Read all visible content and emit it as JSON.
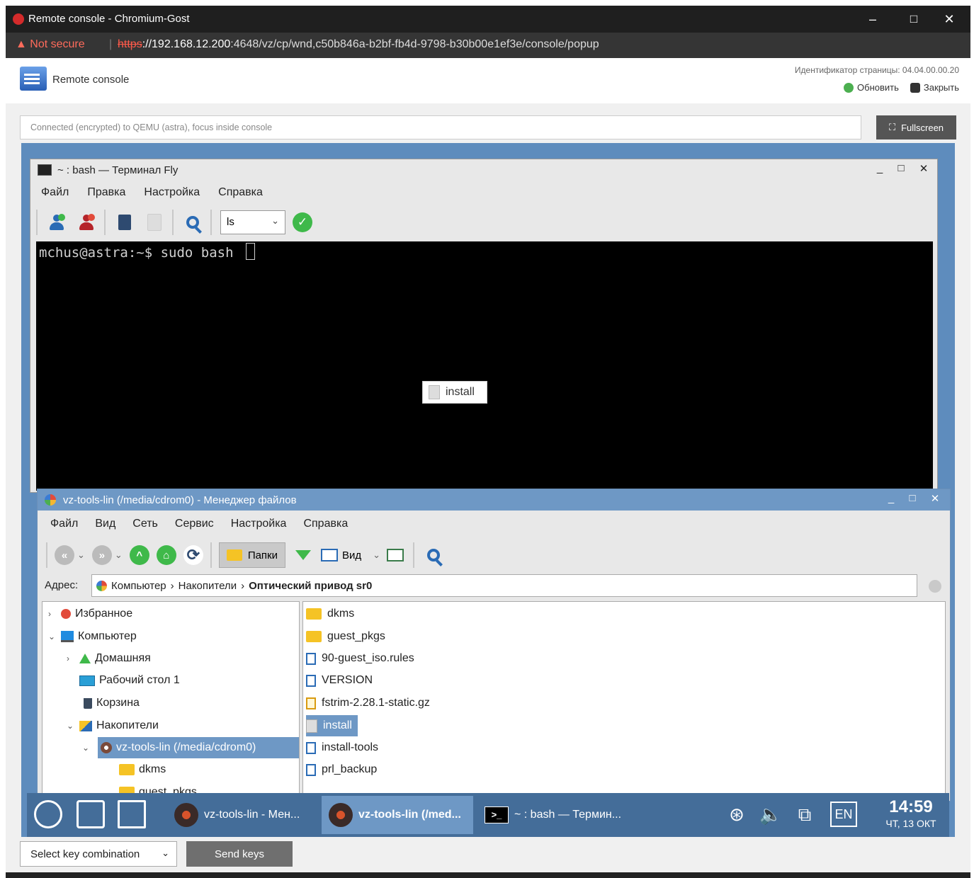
{
  "browser": {
    "window_title": "Remote console - Chromium-Gost",
    "security_warning": "Not secure",
    "url_scheme": "https",
    "url_host": "://192.168.12.200",
    "url_rest": ":4648/vz/cp/wnd,c50b846a-b2bf-fb4d-9798-b30b00e1ef3e/console/popup",
    "controls": {
      "minimize": "–",
      "maximize": "□",
      "close": "✕"
    }
  },
  "page": {
    "title": "Remote console",
    "page_id": "Идентификатор страницы: 04.04.00.00.20",
    "refresh_label": "Обновить",
    "close_label": "Закрыть",
    "status": "Connected (encrypted) to QEMU (astra), focus inside console",
    "fullscreen_label": "Fullscreen",
    "key_combo_placeholder": "Select key combination",
    "send_keys_label": "Send keys"
  },
  "terminal": {
    "title": "~ : bash — Терминал Fly",
    "menu": [
      "Файл",
      "Правка",
      "Настройка",
      "Справка"
    ],
    "command_combo_value": "ls",
    "prompt_line": "mchus@astra:~$ sudo bash ",
    "controls": {
      "minimize": "_",
      "maximize": "□",
      "close": "✕"
    }
  },
  "drag_item": {
    "label": "install"
  },
  "file_manager": {
    "title": "vz-tools-lin (/media/cdrom0) - Менеджер файлов",
    "menu": [
      "Файл",
      "Вид",
      "Сеть",
      "Сервис",
      "Настройка",
      "Справка"
    ],
    "folders_button": "Папки",
    "view_button": "Вид",
    "address_label": "Адрес:",
    "address_crumbs": [
      "Компьютер",
      "Накопители",
      "Оптический привод sr0"
    ],
    "address_sep": "›",
    "tree": [
      {
        "label": "Избранное",
        "arrow": "›"
      },
      {
        "label": "Компьютер",
        "arrow": "⌄"
      },
      {
        "label": "Домашняя",
        "arrow": "›"
      },
      {
        "label": "Рабочий стол 1",
        "arrow": ""
      },
      {
        "label": "Корзина",
        "arrow": ""
      },
      {
        "label": "Накопители",
        "arrow": "⌄"
      },
      {
        "label": "vz-tools-lin (/media/cdrom0)",
        "arrow": "⌄"
      },
      {
        "label": "dkms",
        "arrow": ""
      },
      {
        "label": "guest_pkgs",
        "arrow": ""
      }
    ],
    "files": [
      {
        "name": "dkms",
        "icon": "folder-icon"
      },
      {
        "name": "guest_pkgs",
        "icon": "folder-icon"
      },
      {
        "name": "90-guest_iso.rules",
        "icon": "text-file-icon"
      },
      {
        "name": "VERSION",
        "icon": "text-file-icon"
      },
      {
        "name": "fstrim-2.28.1-static.gz",
        "icon": "archive-icon"
      },
      {
        "name": "install",
        "icon": "script-icon",
        "selected": true
      },
      {
        "name": "install-tools",
        "icon": "text-file-icon"
      },
      {
        "name": "prl_backup",
        "icon": "text-file-icon"
      }
    ],
    "controls": {
      "minimize": "_",
      "maximize": "□",
      "close": "✕"
    }
  },
  "taskbar": {
    "tasks": [
      {
        "label": "vz-tools-lin - Мен..."
      },
      {
        "label": "vz-tools-lin (/med..."
      },
      {
        "label": "~ : bash — Термин..."
      }
    ],
    "terminal_glyph": ">_",
    "language": "EN",
    "time": "14:59",
    "date": "ЧТ, 13 ОКТ"
  }
}
